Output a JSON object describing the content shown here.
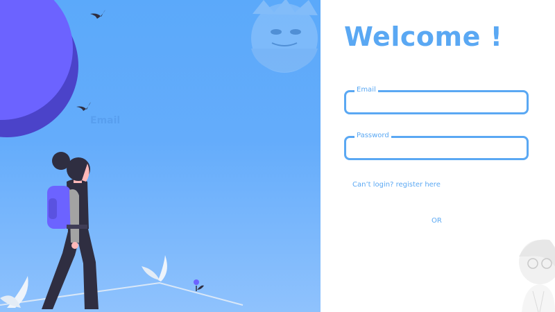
{
  "left_panel": {
    "ghost_label": "Email"
  },
  "login": {
    "title": "Welcome !",
    "email_label": "Email",
    "email_value": "",
    "email_placeholder": "",
    "password_label": "Password",
    "password_value": "",
    "password_placeholder": "",
    "register_link": "Can’t login? register here",
    "or_text": "OR"
  },
  "colors": {
    "accent": "#5aa8f3",
    "background_blue": "#64acfb",
    "planet": "#6c63ff",
    "figure_dark": "#2f2e41",
    "backpack": "#6c63ff"
  }
}
